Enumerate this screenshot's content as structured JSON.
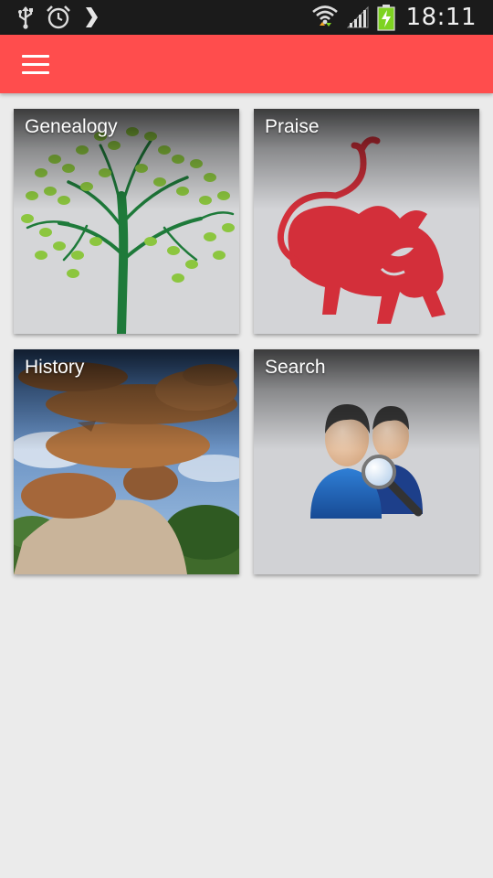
{
  "status_bar": {
    "time": "18:11",
    "icons": [
      "usb-icon",
      "alarm-icon",
      "chevron-right-icon",
      "wifi-icon",
      "signal-icon",
      "battery-charging-icon"
    ]
  },
  "app_bar": {
    "menu_icon": "hamburger-menu-icon",
    "color": "#ff4d4d"
  },
  "tiles": [
    {
      "label": "Genealogy",
      "image": "tree-icon"
    },
    {
      "label": "Praise",
      "image": "bull-icon"
    },
    {
      "label": "History",
      "image": "balancing-rocks-photo"
    },
    {
      "label": "Search",
      "image": "people-search-icon"
    }
  ],
  "colors": {
    "status_bar": "#1b1b1b",
    "background": "#ebebeb",
    "bull_red": "#d32f3a",
    "tree_green": "#1e7a3a",
    "leaf_green": "#8cc63f",
    "battery_green": "#7ed321"
  }
}
